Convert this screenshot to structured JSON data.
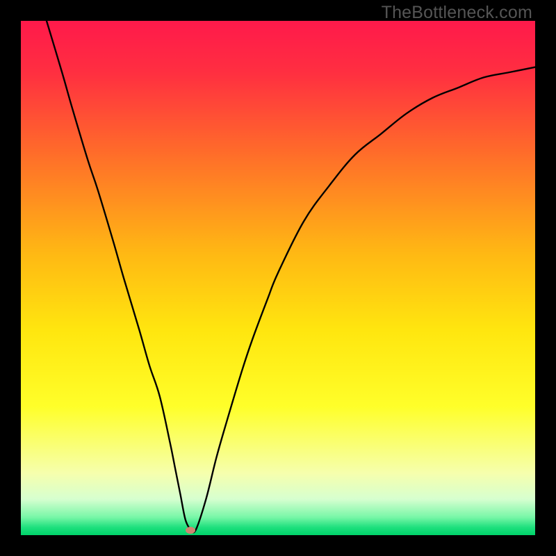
{
  "watermark": "TheBottleneck.com",
  "chart_data": {
    "type": "line",
    "title": "",
    "xlabel": "",
    "ylabel": "",
    "xlim": [
      0,
      100
    ],
    "ylim": [
      0,
      100
    ],
    "grid": false,
    "legend": false,
    "series": [
      {
        "name": "bottleneck-curve",
        "x": [
          5,
          8,
          10,
          13,
          15,
          18,
          20,
          23,
          25,
          27,
          29,
          30,
          31,
          32,
          33,
          34,
          36,
          38,
          40,
          43,
          45,
          48,
          50,
          55,
          60,
          65,
          70,
          75,
          80,
          85,
          90,
          95,
          100
        ],
        "y": [
          100,
          90,
          83,
          73,
          67,
          57,
          50,
          40,
          33,
          27,
          18,
          13,
          8,
          3,
          1,
          1,
          7,
          15,
          22,
          32,
          38,
          46,
          51,
          61,
          68,
          74,
          78,
          82,
          85,
          87,
          89,
          90,
          91
        ]
      }
    ],
    "marker": {
      "x": 33,
      "y": 1,
      "color": "#cf8572"
    },
    "gradient_stops": [
      {
        "pos": 0.0,
        "color": "#ff1a4b"
      },
      {
        "pos": 0.1,
        "color": "#ff2f41"
      },
      {
        "pos": 0.25,
        "color": "#ff6a2b"
      },
      {
        "pos": 0.45,
        "color": "#ffb814"
      },
      {
        "pos": 0.6,
        "color": "#ffe60f"
      },
      {
        "pos": 0.75,
        "color": "#ffff2a"
      },
      {
        "pos": 0.88,
        "color": "#f6ffae"
      },
      {
        "pos": 0.93,
        "color": "#d7ffd0"
      },
      {
        "pos": 0.965,
        "color": "#79f7a8"
      },
      {
        "pos": 0.985,
        "color": "#1ee07e"
      },
      {
        "pos": 1.0,
        "color": "#00d46a"
      }
    ]
  }
}
